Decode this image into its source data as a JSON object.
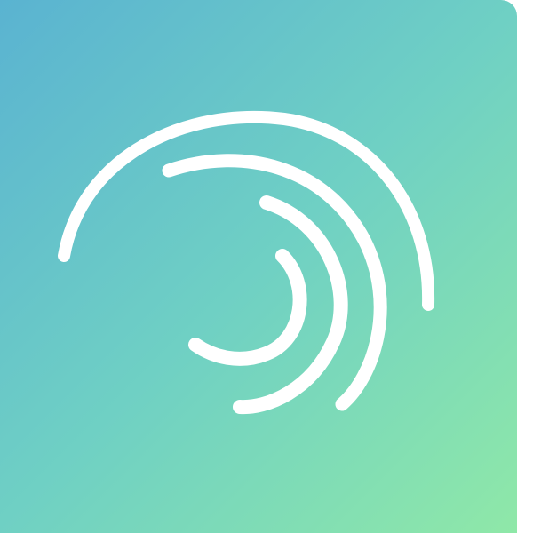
{
  "app_icon": {
    "name": "app-icon",
    "colors": {
      "gradient_start": "#5ab3d1",
      "gradient_mid": "#6fd0c4",
      "gradient_end": "#8fe8a8",
      "logo_stroke": "#ffffff"
    },
    "logo_icon": "concentric-swirl-icon"
  }
}
